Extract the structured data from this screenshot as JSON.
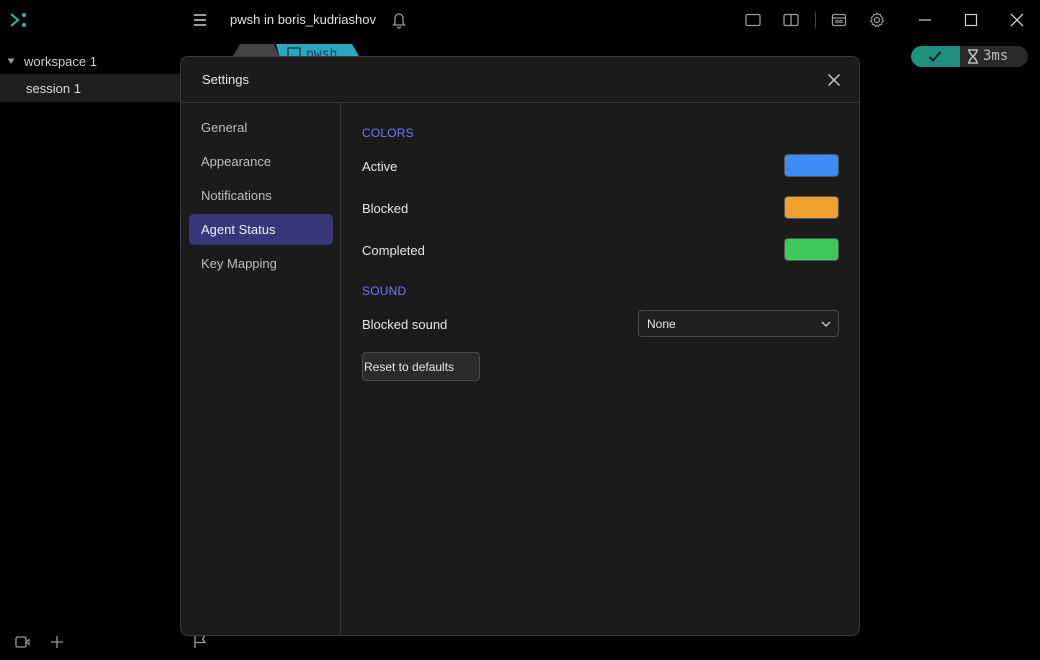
{
  "titlebar": {
    "title": "pwsh in boris_kudriashov"
  },
  "sidebar": {
    "workspace_label": "workspace 1",
    "session_label": "session 1"
  },
  "background": {
    "tab_label": "pwsh",
    "status_time": "3ms"
  },
  "settings": {
    "title": "Settings",
    "nav": [
      {
        "label": "General"
      },
      {
        "label": "Appearance"
      },
      {
        "label": "Notifications"
      },
      {
        "label": "Agent Status",
        "active": true
      },
      {
        "label": "Key Mapping"
      }
    ],
    "colors_section": "COLORS",
    "colors": [
      {
        "label": "Active",
        "color": "#3b8cf5"
      },
      {
        "label": "Blocked",
        "color": "#f0a02e"
      },
      {
        "label": "Completed",
        "color": "#3fc95a"
      }
    ],
    "sound_section": "SOUND",
    "blocked_sound_label": "Blocked sound",
    "blocked_sound_value": "None",
    "reset_label": "Reset to defaults"
  },
  "theme": {
    "accent": "#363678",
    "section_color": "#6e78ff",
    "teal": "#1f8f80"
  }
}
